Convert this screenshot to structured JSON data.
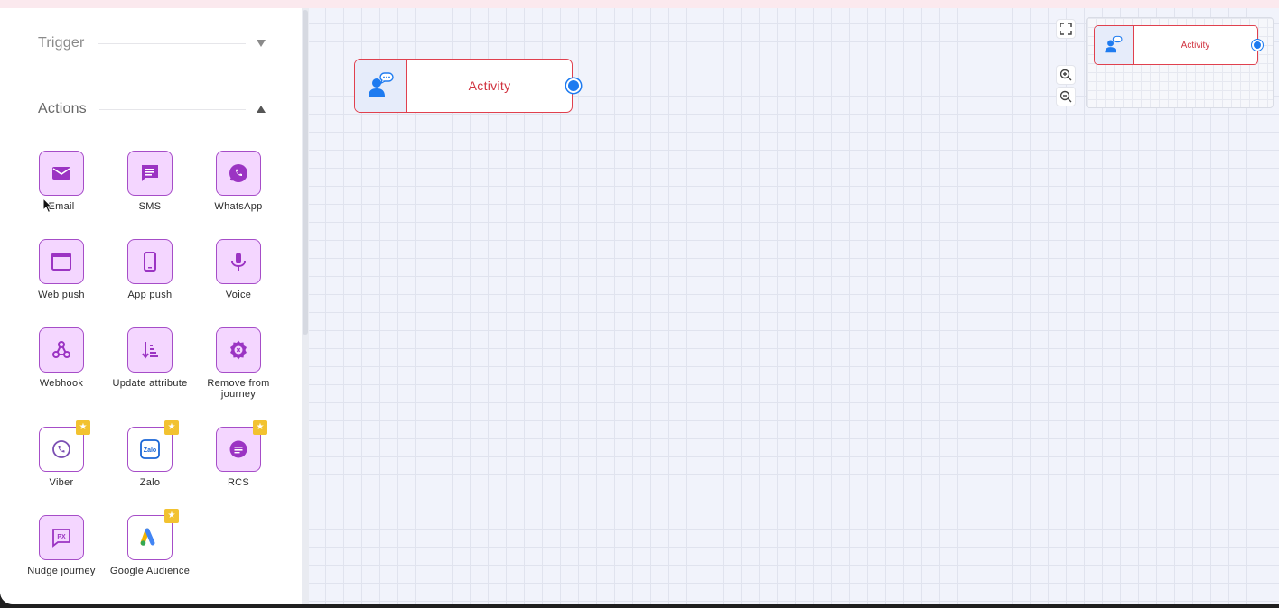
{
  "sidebar": {
    "trigger": {
      "label": "Trigger",
      "expanded": false
    },
    "actions": {
      "label": "Actions",
      "expanded": true,
      "items": [
        {
          "label": "Email",
          "icon": "email-icon",
          "premium": false
        },
        {
          "label": "SMS",
          "icon": "sms-icon",
          "premium": false
        },
        {
          "label": "WhatsApp",
          "icon": "whatsapp-icon",
          "premium": false
        },
        {
          "label": "Web push",
          "icon": "web-push-icon",
          "premium": false
        },
        {
          "label": "App push",
          "icon": "app-push-icon",
          "premium": false
        },
        {
          "label": "Voice",
          "icon": "voice-icon",
          "premium": false
        },
        {
          "label": "Webhook",
          "icon": "webhook-icon",
          "premium": false
        },
        {
          "label": "Update attribute",
          "icon": "update-attribute-icon",
          "premium": false
        },
        {
          "label": "Remove from journey",
          "icon": "remove-from-journey-icon",
          "premium": false
        },
        {
          "label": "Viber",
          "icon": "viber-icon",
          "premium": true
        },
        {
          "label": "Zalo",
          "icon": "zalo-icon",
          "premium": true
        },
        {
          "label": "RCS",
          "icon": "rcs-icon",
          "premium": true
        },
        {
          "label": "Nudge journey",
          "icon": "nudge-journey-icon",
          "premium": false
        },
        {
          "label": "Google Audience",
          "icon": "google-audience-icon",
          "premium": true
        }
      ]
    }
  },
  "canvas": {
    "node": {
      "label": "Activity",
      "icon": "activity-user-chat-icon"
    },
    "minimap": {
      "node_label": "Activity"
    },
    "controls": [
      "fullscreen-icon",
      "zoom-in-icon",
      "zoom-out-icon"
    ]
  },
  "colors": {
    "accent_purple": "#a64dc8",
    "tile_fill": "#f4d6ff",
    "node_border": "#e0404e",
    "node_text": "#d0323f",
    "port_blue": "#1e7bf0",
    "premium_star": "#f2c230"
  }
}
